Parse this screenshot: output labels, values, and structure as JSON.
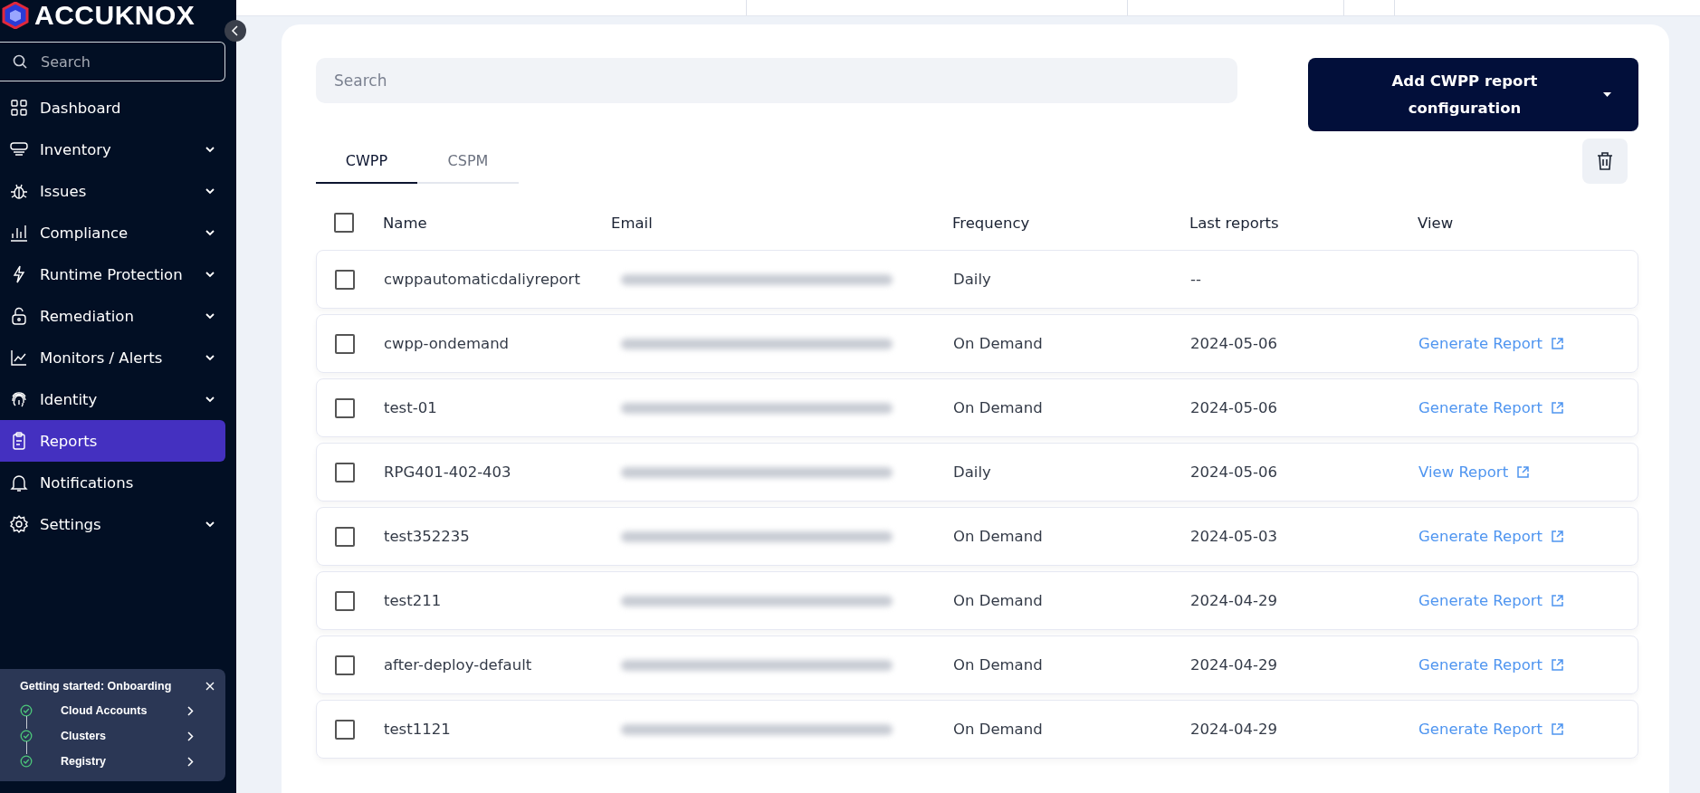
{
  "sidebar": {
    "logo": "ACCUKNOX",
    "search": {
      "placeholder": "Search"
    },
    "items": [
      {
        "label": "Dashboard",
        "expandable": false,
        "selected": false
      },
      {
        "label": "Inventory",
        "expandable": true,
        "selected": false
      },
      {
        "label": "Issues",
        "expandable": true,
        "selected": false
      },
      {
        "label": "Compliance",
        "expandable": true,
        "selected": false
      },
      {
        "label": "Runtime Protection",
        "expandable": true,
        "selected": false
      },
      {
        "label": "Remediation",
        "expandable": true,
        "selected": false
      },
      {
        "label": "Monitors / Alerts",
        "expandable": true,
        "selected": false
      },
      {
        "label": "Identity",
        "expandable": true,
        "selected": false
      },
      {
        "label": "Reports",
        "expandable": false,
        "selected": true
      },
      {
        "label": "Notifications",
        "expandable": false,
        "selected": false
      },
      {
        "label": "Settings",
        "expandable": true,
        "selected": false
      }
    ],
    "onboarding": {
      "title": "Getting started: Onboarding",
      "steps": [
        {
          "label": "Cloud Accounts",
          "done": true
        },
        {
          "label": "Clusters",
          "done": true
        },
        {
          "label": "Registry",
          "done": true
        }
      ]
    }
  },
  "main": {
    "search": {
      "placeholder": "Search"
    },
    "select_all_checked": false,
    "add_button": "Add CWPP report configuration",
    "tabs": [
      {
        "label": "CWPP",
        "selected": true
      },
      {
        "label": "CSPM",
        "selected": false
      }
    ],
    "columns": [
      "Name",
      "Email",
      "Frequency",
      "Last reports",
      "View"
    ],
    "rows": [
      {
        "checked": false,
        "name": "cwppautomaticdaliyreport",
        "frequency": "Daily",
        "last_report": "--"
      },
      {
        "checked": false,
        "name": "cwpp-ondemand",
        "frequency": "On Demand",
        "last_report": "2024-05-06",
        "view": "Generate Report"
      },
      {
        "checked": false,
        "name": "test-01",
        "frequency": "On Demand",
        "last_report": "2024-05-06",
        "view": "Generate Report"
      },
      {
        "checked": false,
        "name": "RPG401-402-403",
        "frequency": "Daily",
        "last_report": "2024-05-06",
        "view": "View Report"
      },
      {
        "checked": false,
        "name": "test352235",
        "frequency": "On Demand",
        "last_report": "2024-05-03",
        "view": "Generate Report"
      },
      {
        "checked": false,
        "name": "test211",
        "frequency": "On Demand",
        "last_report": "2024-04-29",
        "view": "Generate Report"
      },
      {
        "checked": false,
        "name": "after-deploy-default",
        "frequency": "On Demand",
        "last_report": "2024-04-29",
        "view": "Generate Report"
      },
      {
        "checked": false,
        "name": "test1121",
        "frequency": "On Demand",
        "last_report": "2024-04-29",
        "view": "Generate Report"
      }
    ]
  }
}
